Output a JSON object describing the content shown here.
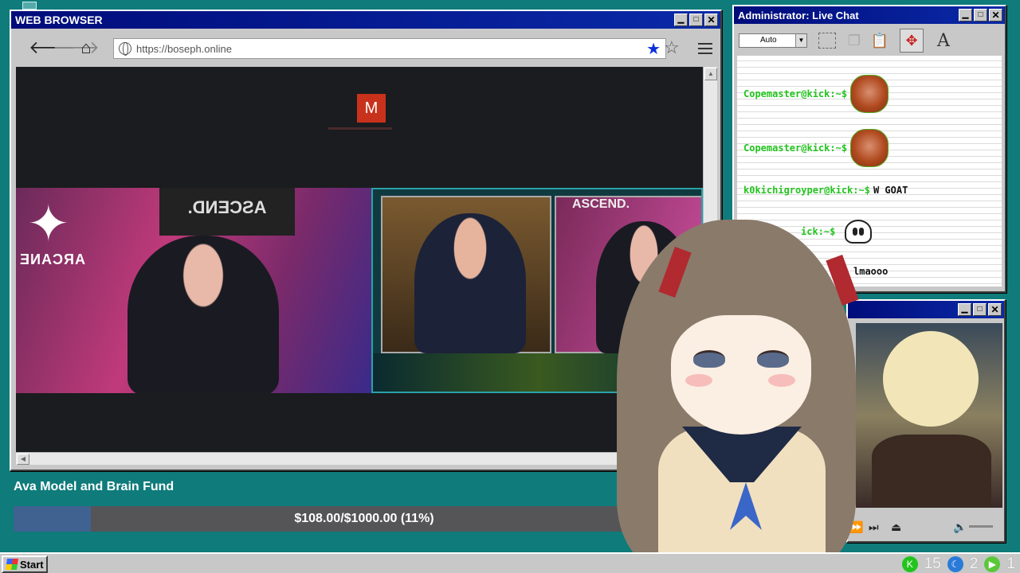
{
  "browser": {
    "title": "WEB BROWSER",
    "url": "https://boseph.online",
    "video_initial": "M"
  },
  "fund": {
    "title": "Ava Model and Brain Fund",
    "progress_text": "$108.00/$1000.00 (11%)",
    "progress_fraction": 0.11,
    "fill_color": "#3f6291"
  },
  "chat": {
    "title": "Administrator: Live Chat",
    "zoom": "Auto",
    "messages": [
      {
        "user": "Copemaster@kick:~$",
        "text": "",
        "emote": "streamer-face"
      },
      {
        "user": "Copemaster@kick:~$",
        "text": "",
        "emote": "streamer-face"
      },
      {
        "user": "k0kichigroyper@kick:~$",
        "text": "W GOAT",
        "emote": ""
      },
      {
        "user": "ick:~$",
        "text": "",
        "emote": "ghost"
      },
      {
        "user": "",
        "text": "lmaooo",
        "emote": ""
      }
    ],
    "user_color": "#23c41e"
  },
  "taskbar": {
    "start_label": "Start",
    "tray": [
      {
        "icon": "kick-icon",
        "count": "15",
        "color": "#23c41e"
      },
      {
        "icon": "moon-icon",
        "count": "2",
        "color": "#2a7ad8"
      },
      {
        "icon": "play-icon",
        "count": "1",
        "color": "#5ac83a"
      }
    ]
  }
}
